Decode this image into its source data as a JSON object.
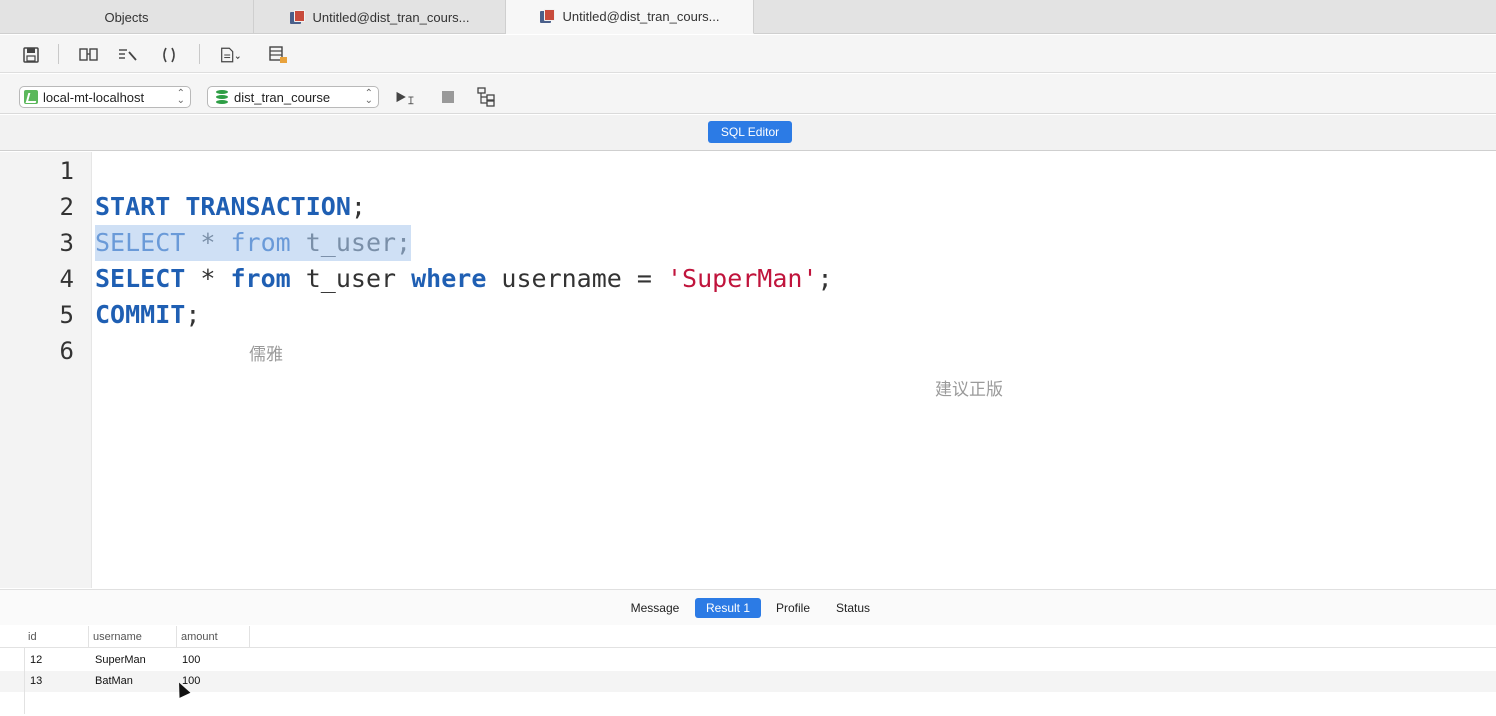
{
  "tabs": [
    {
      "label": "Objects"
    },
    {
      "label": "Untitled@dist_tran_cours..."
    },
    {
      "label": "Untitled@dist_tran_cours..."
    }
  ],
  "toolbar2": {
    "connection": "local-mt-localhost",
    "database": "dist_tran_course"
  },
  "sql_editor_label": "SQL Editor",
  "editor": {
    "line_numbers": [
      "1",
      "2",
      "3",
      "4",
      "5",
      "6"
    ],
    "line2": {
      "kw1": "START",
      "kw2": "TRANSACTION",
      "end": ";"
    },
    "line3": {
      "kw1": "SELECT",
      "op": " * ",
      "kw2": "from",
      "rest": " t_user;"
    },
    "line4": {
      "kw1": "SELECT",
      "op": " * ",
      "kw2": "from",
      "mid": " t_user ",
      "kw3": "where",
      "mid2": " username = ",
      "str": "'SuperMan'",
      "end": ";"
    },
    "line5": {
      "kw1": "COMMIT",
      "end": ";"
    },
    "watermarks": [
      "儒雅",
      "建议正版"
    ]
  },
  "result_tabs": [
    "Message",
    "Result 1",
    "Profile",
    "Status"
  ],
  "grid": {
    "columns": [
      "id",
      "username",
      "amount"
    ],
    "rows": [
      [
        "12",
        "SuperMan",
        "100"
      ],
      [
        "13",
        "BatMan",
        "100"
      ]
    ]
  },
  "colors": {
    "accent": "#2c7be5",
    "keyword": "#1f5fb3",
    "string": "#c0143c",
    "selection": "#cfe0f5"
  }
}
